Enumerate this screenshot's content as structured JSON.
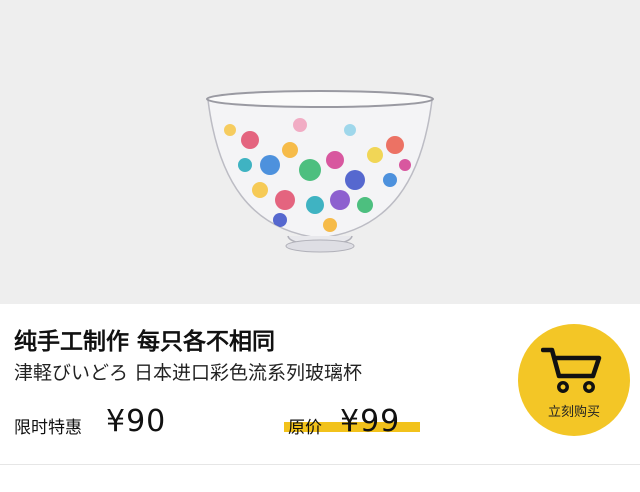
{
  "product": {
    "title": "纯手工制作 每只各不相同",
    "subtitle": "津軽びいどろ  日本进口彩色流系列玻璃杯",
    "image_icon": "glass-bowl-image"
  },
  "pricing": {
    "sale_label": "限时特惠",
    "sale_price": "¥90",
    "original_label": "原价",
    "original_price": "¥99",
    "highlight_color": "#f2c21b"
  },
  "buy_button": {
    "label": "立刻购买",
    "icon": "cart-icon",
    "color": "#f3c626"
  }
}
